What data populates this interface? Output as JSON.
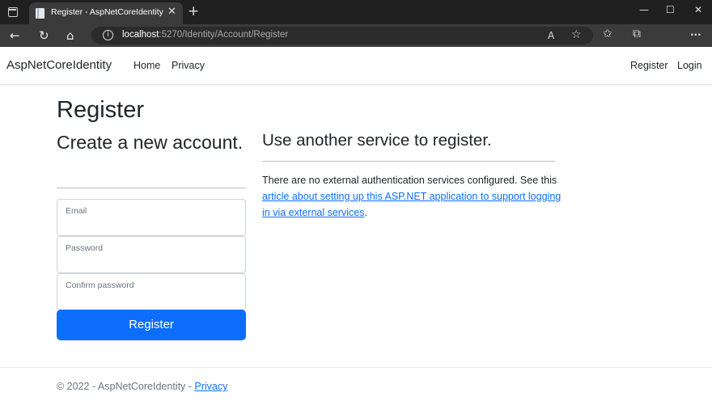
{
  "browser": {
    "tab_title": "Register - AspNetCoreIdentity",
    "tab_close": "✕",
    "new_tab": "+",
    "url_host": "localhost",
    "url_path": ":5270/Identity/Account/Register",
    "window_controls": {
      "minimize": "—",
      "maximize": "☐",
      "close": "✕"
    },
    "nav_icons": {
      "back": "←",
      "refresh": "↻",
      "home": "⌂",
      "info": "i"
    },
    "right_icons": {
      "read_aloud": "A",
      "favorite": "☆",
      "favorites": "✩",
      "collections": "⧉",
      "more": "···"
    }
  },
  "site": {
    "brand": "AspNetCoreIdentity",
    "nav": {
      "home": "Home",
      "privacy": "Privacy",
      "register": "Register",
      "login": "Login"
    }
  },
  "main": {
    "title": "Register",
    "subtitle": "Create a new account.",
    "fields": {
      "email": {
        "label": "Email",
        "value": ""
      },
      "password": {
        "label": "Password",
        "value": ""
      },
      "confirm": {
        "label": "Confirm password",
        "value": ""
      }
    },
    "submit": "Register",
    "external": {
      "heading": "Use another service to register.",
      "text_before": "There are no external authentication services configured. See this ",
      "link_text": "article about setting up this ASP.NET application to support logging in via external services",
      "text_after": "."
    }
  },
  "footer": {
    "copyright": "© 2022 - AspNetCoreIdentity - ",
    "privacy_link": "Privacy"
  },
  "colors": {
    "primary": "#0d6efd",
    "text": "#212529",
    "muted": "#6c757d",
    "chrome_dark": "#202020",
    "chrome_mid": "#3b3b3b"
  }
}
